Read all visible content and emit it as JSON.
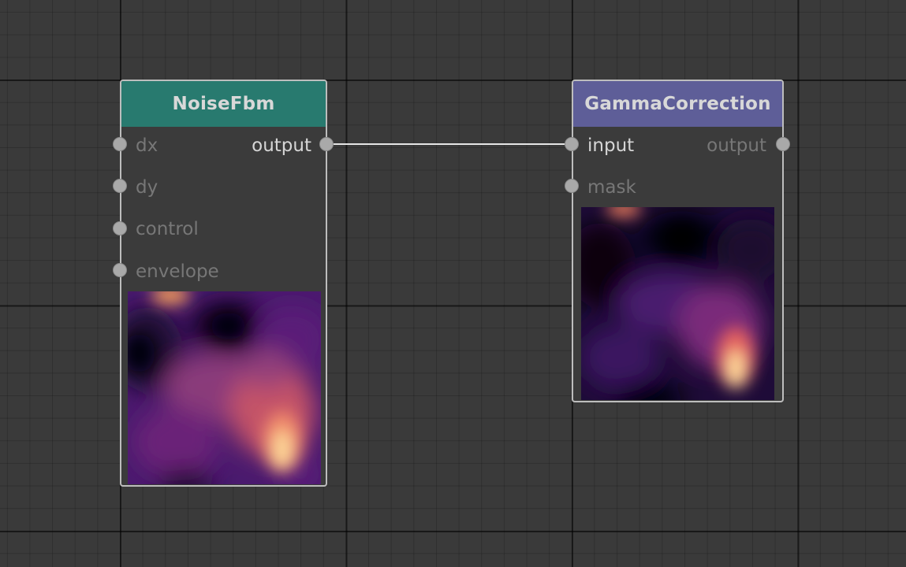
{
  "nodes": {
    "noise": {
      "title": "NoiseFbm",
      "header_color": "#287a6f",
      "inputs": [
        "dx",
        "dy",
        "control",
        "envelope"
      ],
      "output": "output"
    },
    "gamma": {
      "title": "GammaCorrection",
      "header_color": "#5e5e98",
      "inputs": [
        "input",
        "mask"
      ],
      "output": "output"
    }
  },
  "connection": {
    "from": "NoiseFbm.output",
    "to": "GammaCorrection.input",
    "color": "#e6e6e6"
  },
  "preview_palette": "magma"
}
